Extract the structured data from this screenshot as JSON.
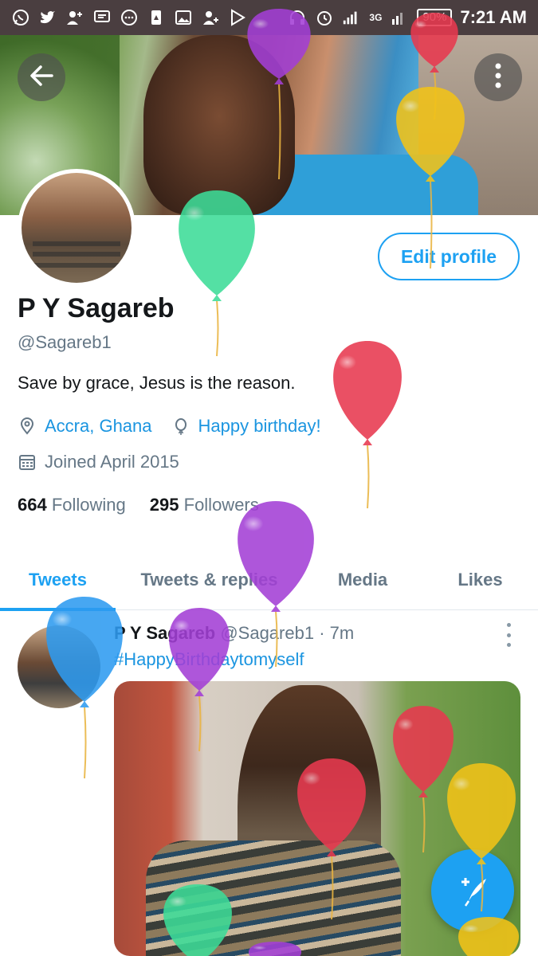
{
  "status_bar": {
    "battery": "90%",
    "time": "7:21 AM",
    "network": "3G"
  },
  "profile": {
    "name": "P Y Sagareb",
    "handle": "@Sagareb1",
    "bio": "Save by grace, Jesus is the reason.",
    "location": "Accra, Ghana",
    "birthday": "Happy birthday!",
    "joined": "Joined April 2015",
    "following_count": "664",
    "following_label": "Following",
    "followers_count": "295",
    "followers_label": "Followers",
    "edit_button": "Edit profile"
  },
  "tabs": [
    {
      "label": "Tweets",
      "active": true
    },
    {
      "label": "Tweets & replies",
      "active": false
    },
    {
      "label": "Media",
      "active": false
    },
    {
      "label": "Likes",
      "active": false
    }
  ],
  "tweet": {
    "name": "P Y Sagareb",
    "handle": "@Sagareb1",
    "separator": "·",
    "time": "7m",
    "text": "#HappyBirthdaytomyself"
  },
  "colors": {
    "accent": "#1da1f2",
    "link": "#1b95e0",
    "status_bar": "#4a3e40",
    "balloon_colors": [
      "#a33fd6",
      "#e8394f",
      "#f2c318",
      "#3ddc98",
      "#2e9bf0"
    ]
  },
  "icons": {
    "back": "arrow-left-icon",
    "more": "more-vertical-icon",
    "location": "location-pin-icon",
    "birthday": "balloon-icon",
    "calendar": "calendar-icon",
    "compose": "compose-tweet-icon"
  }
}
